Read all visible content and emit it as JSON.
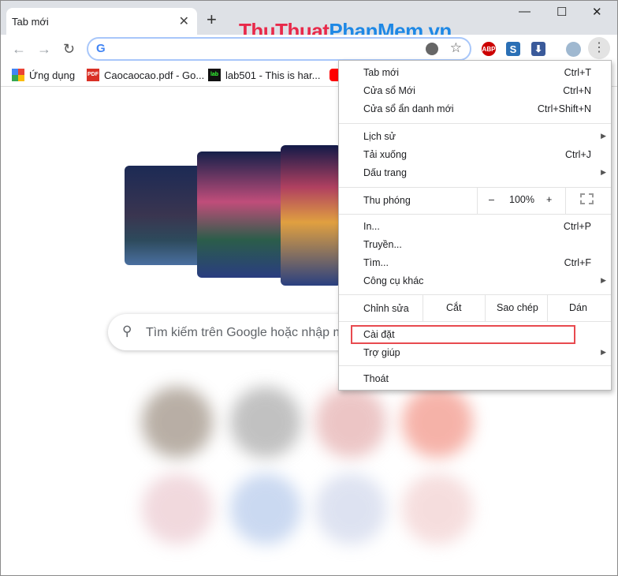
{
  "window": {
    "tab_title": "Tab mới",
    "new_tab": "+",
    "minimize": "—",
    "maximize": "☐",
    "close": "✕"
  },
  "watermark": {
    "part1": "ThuThuat",
    "part2": "PhanMem.vn"
  },
  "toolbar": {
    "back": "←",
    "forward": "→",
    "reload": "↻",
    "omnibox_value": "",
    "google": "G",
    "star": "☆",
    "ext_abp": "ABP",
    "ext_s": "S",
    "ext_dl": "⬇",
    "menu": "⋮"
  },
  "bookmarks": [
    {
      "label": "Ứng dụng",
      "icon": "apps-grid-icon"
    },
    {
      "label": "Caocaocao.pdf - Go...",
      "icon": "PDF"
    },
    {
      "label": "lab501 - This is har...",
      "icon": "lab"
    },
    {
      "label": "",
      "icon": "youtube-icon"
    }
  ],
  "search": {
    "placeholder": "Tìm kiếm trên Google hoặc nhập m"
  },
  "menu": {
    "group1": [
      {
        "label": "Tab mới",
        "shortcut": "Ctrl+T"
      },
      {
        "label": "Cửa sổ Mới",
        "shortcut": "Ctrl+N"
      },
      {
        "label": "Cửa sổ ẩn danh mới",
        "shortcut": "Ctrl+Shift+N"
      }
    ],
    "group2": [
      {
        "label": "Lịch sử",
        "shortcut": ""
      },
      {
        "label": "Tải xuống",
        "shortcut": "Ctrl+J"
      },
      {
        "label": "Dấu trang",
        "shortcut": ""
      }
    ],
    "zoom": {
      "label": "Thu phóng",
      "minus": "–",
      "value": "100%",
      "plus": "+"
    },
    "group3": [
      {
        "label": "In...",
        "shortcut": "Ctrl+P"
      },
      {
        "label": "Truyền...",
        "shortcut": ""
      },
      {
        "label": "Tìm...",
        "shortcut": "Ctrl+F"
      },
      {
        "label": "Công cụ khác",
        "shortcut": ""
      }
    ],
    "edit": {
      "label": "Chỉnh sửa",
      "cut": "Cắt",
      "copy": "Sao chép",
      "paste": "Dán"
    },
    "settings": "Cài đặt",
    "help": "Trợ giúp",
    "exit": "Thoát"
  }
}
